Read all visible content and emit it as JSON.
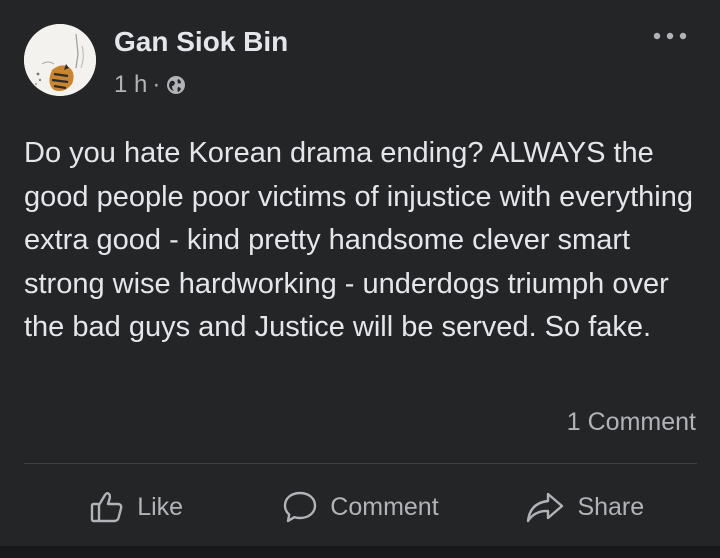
{
  "post": {
    "author": "Gan Siok Bin",
    "time": "1 h",
    "separator": "·",
    "privacy_icon": "globe-icon",
    "menu_icon": "more-options-icon",
    "text": "Do you hate Korean drama ending? ALWAYS the good people poor victims of injustice with everything extra good - kind pretty handsome clever smart strong wise hardworking - underdogs triumph over the bad guys and Justice will be served. So fake.",
    "comments_count": "1 Comment"
  },
  "actions": {
    "like": {
      "label": "Like",
      "icon": "thumbs-up-icon"
    },
    "comment": {
      "label": "Comment",
      "icon": "comment-bubble-icon"
    },
    "share": {
      "label": "Share",
      "icon": "share-arrow-icon"
    }
  },
  "colors": {
    "background": "#242526",
    "primary_text": "#e4e6eb",
    "secondary_text": "#b0b3b8",
    "divider": "#3e4042"
  }
}
